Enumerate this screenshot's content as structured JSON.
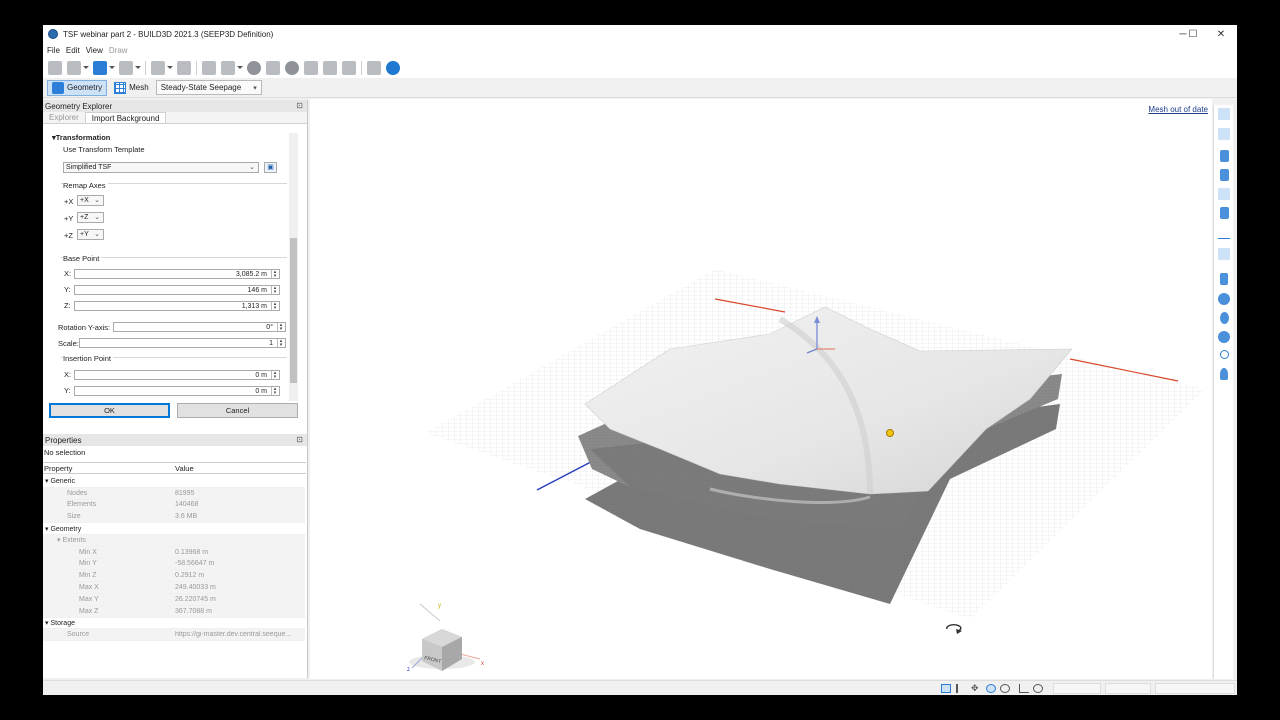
{
  "window": {
    "title": "TSF webinar part 2 - BUILD3D 2021.3 (SEEP3D Definition)",
    "controls": [
      "─",
      "☐",
      "✕"
    ]
  },
  "menu": {
    "file": "File",
    "edit": "Edit",
    "view": "View",
    "draw": "Draw"
  },
  "modebar": {
    "geometry": "Geometry",
    "mesh": "Mesh",
    "analysis": "Steady-State Seepage"
  },
  "geometry_explorer": {
    "title": "Geometry Explorer",
    "tabs": {
      "explorer": "Explorer",
      "import": "Import Background"
    },
    "transformation": "Transformation",
    "use_template": "Use Transform Template",
    "template_value": "Simplified TSF",
    "remap_axes": "Remap Axes",
    "remap": {
      "x_label": "+X",
      "x_value": "+X",
      "y_label": "+Y",
      "y_value": "+Z",
      "z_label": "+Z",
      "z_value": "+Y"
    },
    "base_point": "Base Point",
    "base": {
      "x_label": "X:",
      "x": "3,085.2 m",
      "y_label": "Y:",
      "y": "146 m",
      "z_label": "Z:",
      "z": "1,313 m"
    },
    "rotation_label": "Rotation Y-axis:",
    "rotation": "0°",
    "scale_label": "Scale:",
    "scale": "1",
    "insertion_point": "Insertion Point",
    "insertion": {
      "x_label": "X:",
      "x": "0 m",
      "y_label": "Y:",
      "y": "0 m"
    },
    "ok": "OK",
    "cancel": "Cancel"
  },
  "properties": {
    "title": "Properties",
    "selection": "No selection",
    "headers": {
      "property": "Property",
      "value": "Value"
    },
    "groups": {
      "generic": "Generic",
      "geometry": "Geometry",
      "extents": "Extents",
      "storage": "Storage"
    },
    "generic_rows": [
      {
        "k": "Nodes",
        "v": "81995"
      },
      {
        "k": "Elements",
        "v": "140468"
      },
      {
        "k": "Size",
        "v": "3.6 MB"
      }
    ],
    "extent_rows": [
      {
        "k": "Min X",
        "v": "0.13968 m"
      },
      {
        "k": "Min Y",
        "v": "-58.56647 m"
      },
      {
        "k": "Min Z",
        "v": "0.2912 m"
      },
      {
        "k": "Max X",
        "v": "249.40033 m"
      },
      {
        "k": "Max Y",
        "v": "26.220745 m"
      },
      {
        "k": "Max Z",
        "v": "367.7088 m"
      }
    ],
    "storage_rows": [
      {
        "k": "Source",
        "v": "https://gi-master.dev.central.seeque..."
      }
    ]
  },
  "viewport": {
    "mesh_status": "Mesh out of date",
    "cube_label": "FRONT",
    "axis_x": "x",
    "axis_y": "y",
    "axis_z": "z"
  },
  "colors": {
    "accent": "#2a7cd4",
    "surface": "#ececec",
    "dark_layer": "#7a7a7a",
    "x_axis": "#d9482b",
    "z_axis": "#2a3fbf"
  }
}
